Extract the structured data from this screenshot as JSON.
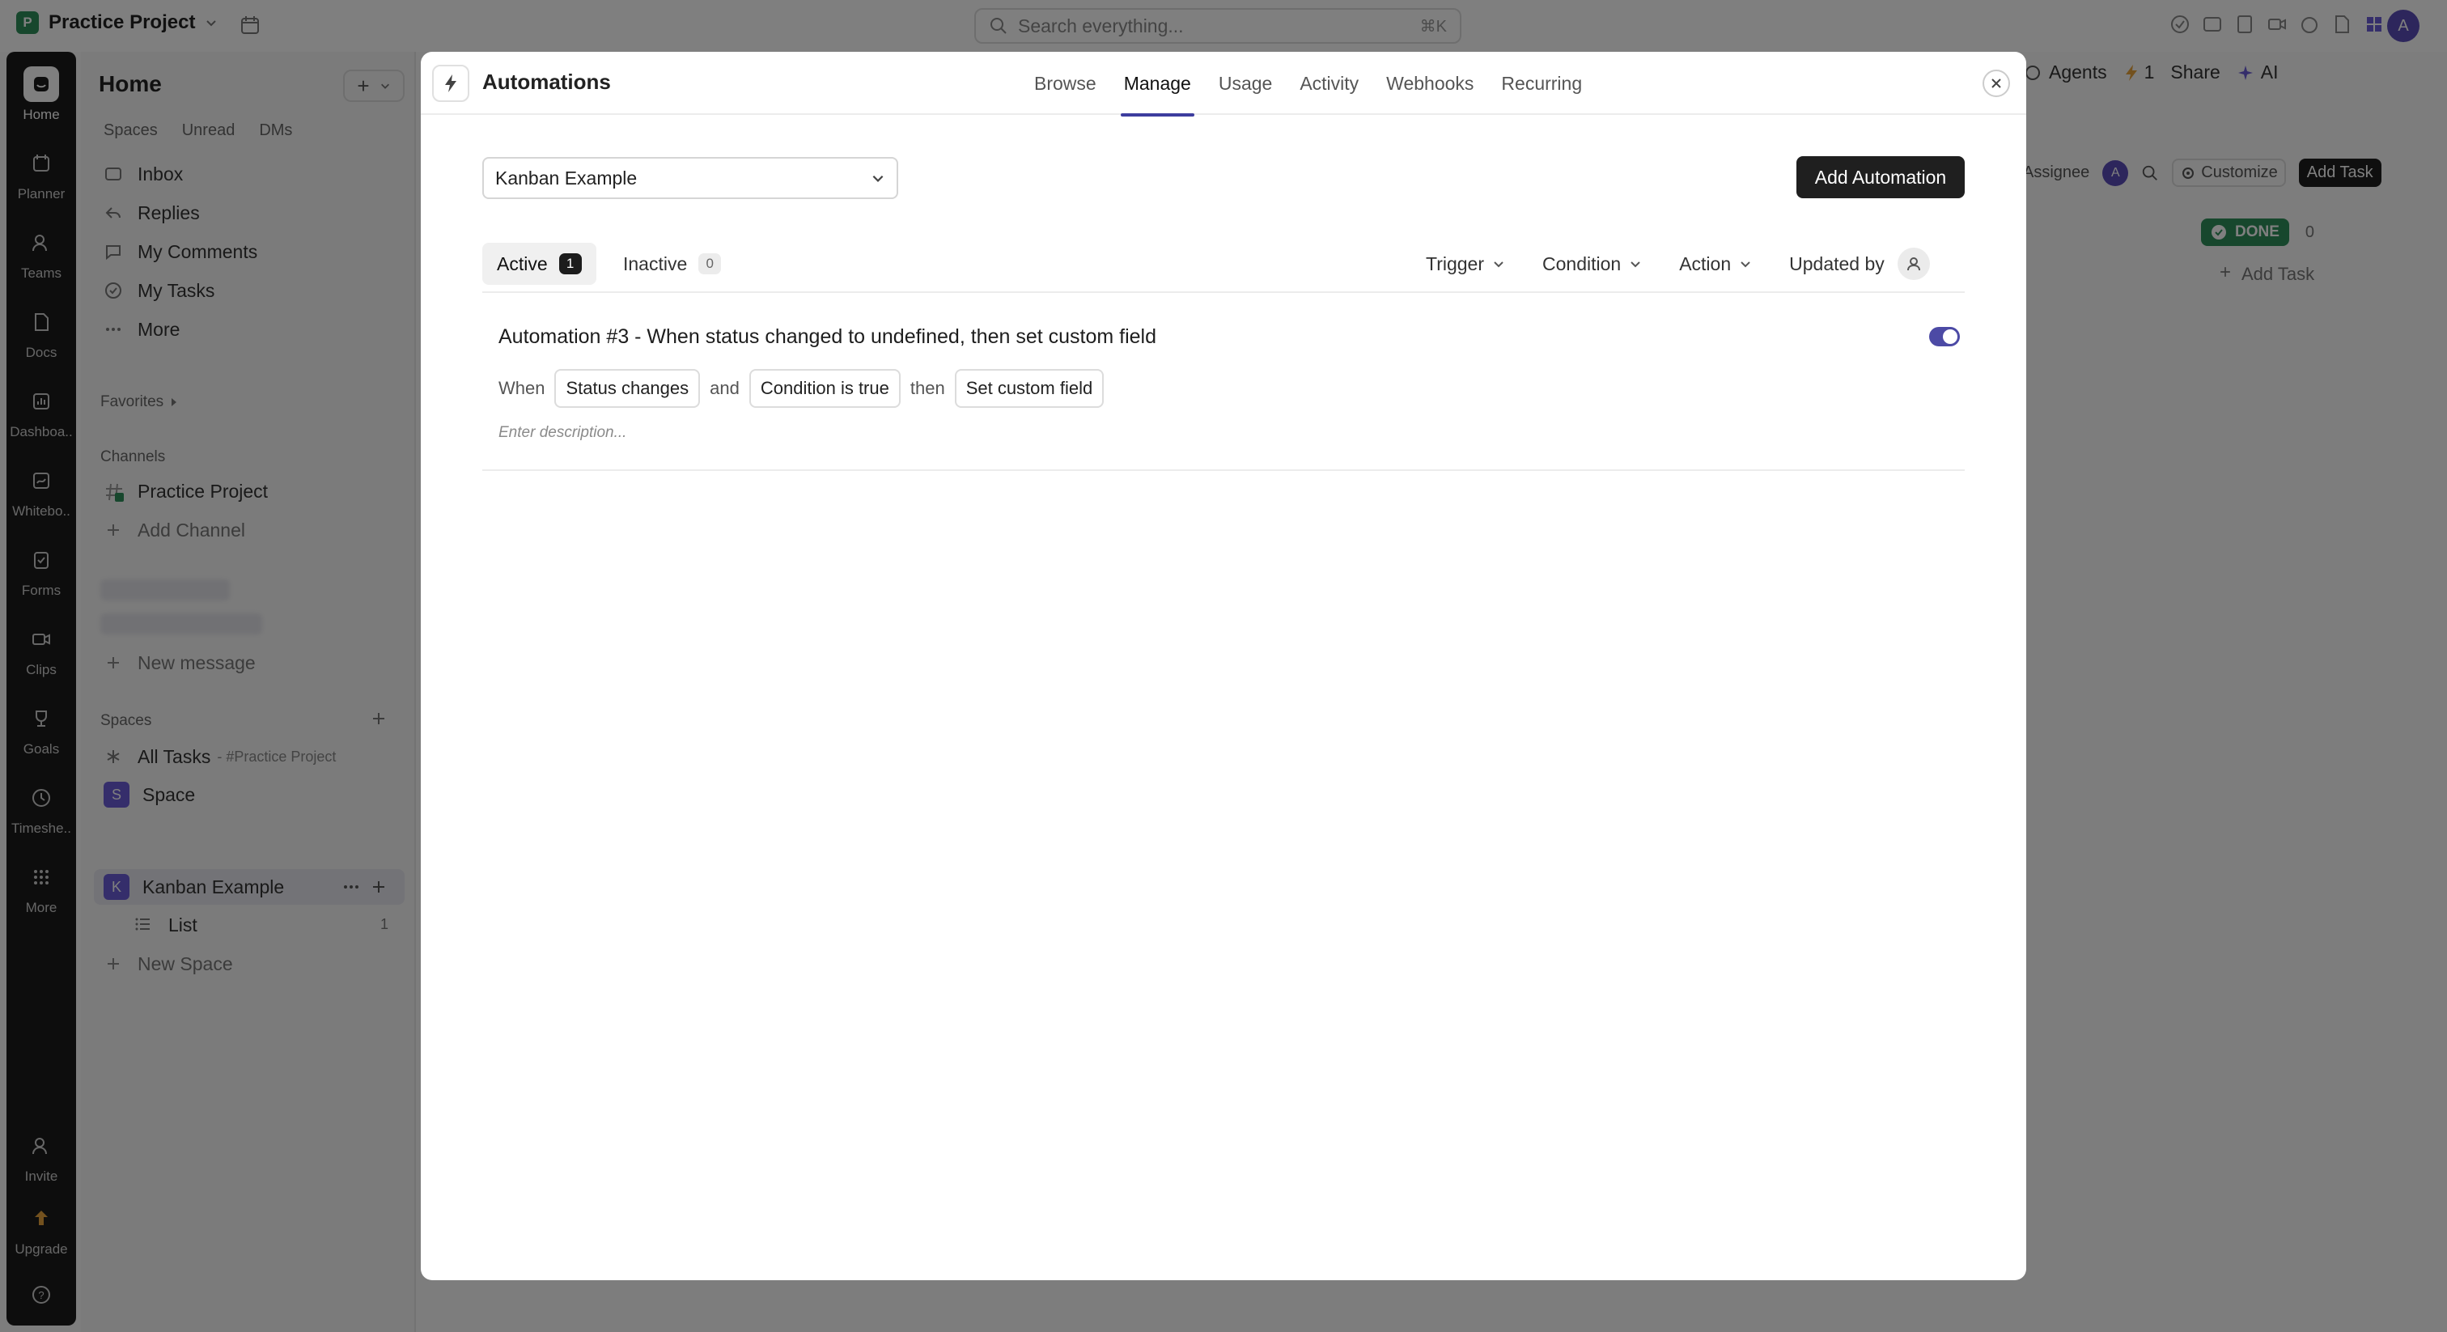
{
  "topbar": {
    "project_badge": "P",
    "project_name": "Practice Project",
    "search_placeholder": "Search everything...",
    "search_shortcut": "⌘K",
    "avatar_initial": "A"
  },
  "rail": [
    {
      "label": "Home",
      "icon": "home-icon"
    },
    {
      "label": "Planner",
      "icon": "calendar-icon"
    },
    {
      "label": "Teams",
      "icon": "teams-icon"
    },
    {
      "label": "Docs",
      "icon": "doc-icon"
    },
    {
      "label": "Dashboa..",
      "icon": "dashboard-icon"
    },
    {
      "label": "Whitebo..",
      "icon": "whiteboard-icon"
    },
    {
      "label": "Forms",
      "icon": "forms-icon"
    },
    {
      "label": "Clips",
      "icon": "clips-icon"
    },
    {
      "label": "Goals",
      "icon": "trophy-icon"
    },
    {
      "label": "Timeshe..",
      "icon": "clock-icon"
    },
    {
      "label": "More",
      "icon": "grid-icon"
    },
    {
      "label": "Invite",
      "icon": "invite-icon"
    },
    {
      "label": "Upgrade",
      "icon": "upgrade-icon"
    }
  ],
  "sidebar": {
    "title": "Home",
    "add_label": "+",
    "tabs": [
      "Spaces",
      "Unread",
      "DMs"
    ],
    "nav": [
      {
        "label": "Inbox",
        "icon": "inbox-icon"
      },
      {
        "label": "Replies",
        "icon": "replies-icon"
      },
      {
        "label": "My Comments",
        "icon": "comment-icon"
      },
      {
        "label": "My Tasks",
        "icon": "check-circle-icon"
      },
      {
        "label": "More",
        "icon": "more-icon"
      }
    ],
    "favorites": "Favorites",
    "channels_title": "Channels",
    "channels": [
      "Practice Project"
    ],
    "add_channel": "Add Channel",
    "new_message": "New message",
    "spaces_title": "Spaces",
    "all_tasks": "All Tasks",
    "all_tasks_sub": "- #Practice Project",
    "spaces": [
      {
        "badge": "S",
        "name": "Space"
      },
      {
        "badge": "K",
        "name": "Kanban Example"
      }
    ],
    "list_item": "List",
    "list_count": "1",
    "new_space": "New Space"
  },
  "background": {
    "agents": "Agents",
    "bolt_count": "1",
    "share": "Share",
    "ai": "AI",
    "assignee": "Assignee",
    "assignee_initial": "A",
    "customize": "Customize",
    "add_task_btn": "Add Task",
    "done_label": "DONE",
    "done_count": "0",
    "add_task_link": "Add Task"
  },
  "modal": {
    "title": "Automations",
    "tabs": [
      "Browse",
      "Manage",
      "Usage",
      "Activity",
      "Webhooks",
      "Recurring"
    ],
    "active_tab": "Manage",
    "space_select": "Kanban Example",
    "add_button": "Add Automation",
    "states": [
      {
        "label": "Active",
        "count": "1"
      },
      {
        "label": "Inactive",
        "count": "0"
      }
    ],
    "filters": [
      "Trigger",
      "Condition",
      "Action",
      "Updated by"
    ],
    "automations": [
      {
        "title": "Automation #3 - When status changed to undefined, then set custom field",
        "enabled": true,
        "when": "When",
        "trigger": "Status changes",
        "and": "and",
        "condition": "Condition is true",
        "then": "then",
        "action": "Set custom field",
        "description_placeholder": "Enter description..."
      }
    ]
  },
  "colors": {
    "accent": "#3d3d9e",
    "toggle_on": "#4c4aa5",
    "rail_bg": "#1b1b1b",
    "done_green": "#2f8f5b",
    "space_purple": "#6a5cd6"
  }
}
